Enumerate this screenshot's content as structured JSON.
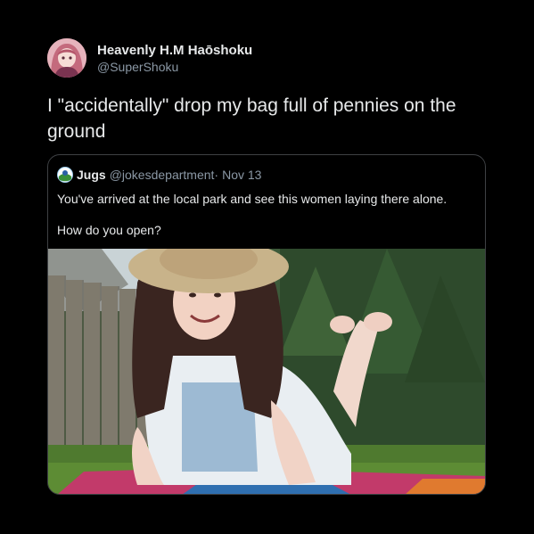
{
  "tweet": {
    "author_name": "Heavenly H.M Haōshoku",
    "author_handle": "@SuperShoku",
    "text": "I \"accidentally\" drop my bag full of pennies on the ground"
  },
  "quoted_tweet": {
    "author_name": "Jugs",
    "author_handle": "@jokesdepartment",
    "separator": "·",
    "date": "Nov 13",
    "line1": "You've arrived at the local park and see this women laying there alone.",
    "line2": "How do you open?"
  },
  "colors": {
    "background": "#000000",
    "text": "#e7e9ea",
    "muted": "#8b98a5",
    "border": "#3e4144"
  }
}
